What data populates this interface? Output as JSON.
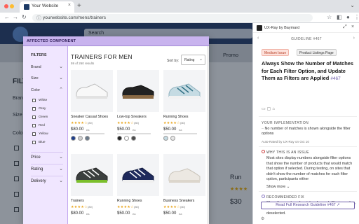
{
  "browser": {
    "tab_title": "Your Website",
    "tab_close": "×",
    "new_tab": "+",
    "url": "yourwebsite.com/mens/trainers"
  },
  "site": {
    "search_placeholder": "Search",
    "promo": "Promo",
    "filter_heading": "FILTE",
    "labels": [
      "Brand",
      "Size",
      "Colo"
    ],
    "product_name_partial": "Run",
    "stars": "★★★★",
    "price_partial": "$30"
  },
  "modal": {
    "header": "AFFECTED COMPONENT",
    "filters": {
      "title": "FILTERS",
      "groups": [
        "Brand",
        "Size",
        "Color"
      ],
      "colors": [
        "White",
        "Gray",
        "Green",
        "Red",
        "Yellow",
        "Blue"
      ],
      "bottom_groups": [
        "Price",
        "Rating",
        "Delivery"
      ]
    },
    "results_title": "TRAINERS FOR MEN",
    "results_count": "59 of 260 results",
    "sort_label": "Sort by:",
    "sort_value": "Rating",
    "products": [
      {
        "name": "Sneaker Casual Shoes",
        "stars": "★★★★☆",
        "count": "(80)",
        "price": "$80.00",
        "unit": "ea"
      },
      {
        "name": "Low-top Sneakers",
        "stars": "★★★★☆",
        "count": "(80)",
        "price": "$50.00",
        "unit": "ea"
      },
      {
        "name": "Running Shoes",
        "stars": "★★★★☆",
        "count": "(80)",
        "price": "$50.00",
        "unit": "ea"
      },
      {
        "name": "Trainers",
        "stars": "★★★★☆",
        "count": "(80)",
        "price": "$80.00",
        "unit": "ea"
      },
      {
        "name": "Running Shoes",
        "stars": "★★★★☆",
        "count": "(80)",
        "price": "$50.00",
        "unit": "ea"
      },
      {
        "name": "Business Sneakers",
        "stars": "★★★★☆",
        "count": "(80)",
        "price": "$50.00",
        "unit": "ea"
      }
    ],
    "swatch_colors": [
      "#1f3f8a",
      "#cfcfcf",
      "#6b7a8a",
      "#222222",
      "#ffffff",
      "#4b4b4b",
      "#c5dbe3",
      "#e6e6e6"
    ]
  },
  "panel": {
    "app_name": "UX-Ray by Baymard",
    "guideline_id": "GUIDELINE #467",
    "badge_issue": "Medium Issue",
    "badge_page": "Product Listings Page",
    "title": "Always Show the Number of Matches for Each Filter Option, and Update Them as Filters are Applied",
    "title_num": "#467",
    "your_impl": "YOUR IMPLEMENTATION",
    "impl_text": "No number of matches is shown alongside the filter options",
    "auto_rated": "Auto-Rated by UX-Ray on Oct 10",
    "why_label": "WHY THIS IS AN ISSUE",
    "why_text": "Most sites display numbers alongside filter options that show the number of products that would match that option if selected. During testing, on sites that didn't show the number of matches for each filter option, participants either",
    "show_more": "Show more ⌄",
    "rec_label": "RECOMMENDED FIX",
    "rec_text": "Show the number of matches for each filtering option, and live update the numbers as filters are applied or deselected.",
    "cta": "Read Full Research Guideline #467 ↗"
  },
  "colors": {
    "accent": "#6c5aa8",
    "issue": "#b8432a",
    "filter_bg": "#f0e6ff",
    "stars": "#e8a317"
  }
}
